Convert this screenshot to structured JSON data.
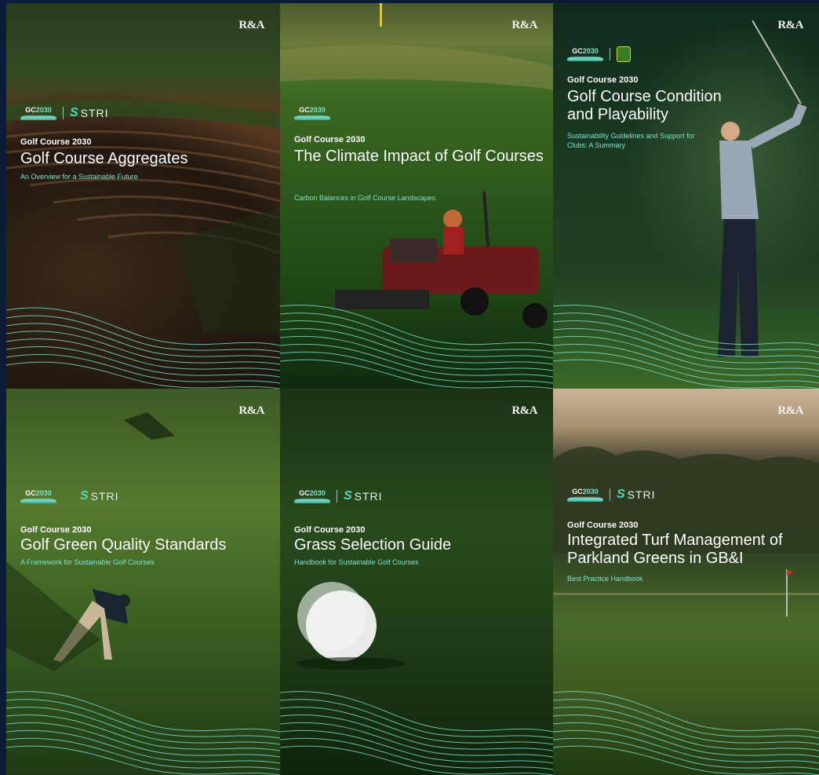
{
  "covers": [
    {
      "brand": "R&A",
      "gc_logo": {
        "prefix": "GC",
        "year": "2030"
      },
      "partner": "STRI",
      "series": "Golf Course 2030",
      "title": "Golf Course Aggregates",
      "subtitle": "An Overview for a Sustainable Future"
    },
    {
      "brand": "R&A",
      "gc_logo": {
        "prefix": "GC",
        "year": "2030"
      },
      "partner": "",
      "series": "Golf Course 2030",
      "title": "The Climate Impact of Golf Courses",
      "subtitle": "Carbon Balances in Golf Course Landscapes"
    },
    {
      "brand": "R&A",
      "gc_logo": {
        "prefix": "GC",
        "year": "2030"
      },
      "partner": "",
      "series": "Golf Course 2030",
      "title": "Golf Course Condition and Playability",
      "subtitle": "Sustainability Guidelines and Support for Clubs: A Summary"
    },
    {
      "brand": "R&A",
      "gc_logo": {
        "prefix": "GC",
        "year": "2030"
      },
      "partner": "STRI",
      "series": "Golf Course 2030",
      "title": "Golf Green Quality Standards",
      "subtitle": "A Framework for Sustainable Golf Courses"
    },
    {
      "brand": "R&A",
      "gc_logo": {
        "prefix": "GC",
        "year": "2030"
      },
      "partner": "STRI",
      "series": "Golf Course 2030",
      "title": "Grass Selection Guide",
      "subtitle": "Handbook for Sustainable Golf Courses"
    },
    {
      "brand": "R&A",
      "gc_logo": {
        "prefix": "GC",
        "year": "2030"
      },
      "partner": "STRI",
      "series": "Golf Course 2030",
      "title": "Integrated Turf Management of Parkland Greens in GB&I",
      "subtitle": "Best Practice Handbook"
    }
  ],
  "colors": {
    "accent": "#7fe3d0",
    "page_bg": "#0b1d3a"
  },
  "icons": {
    "partner_mark": "stri-swoosh-icon",
    "wave": "wave-lines-icon"
  }
}
